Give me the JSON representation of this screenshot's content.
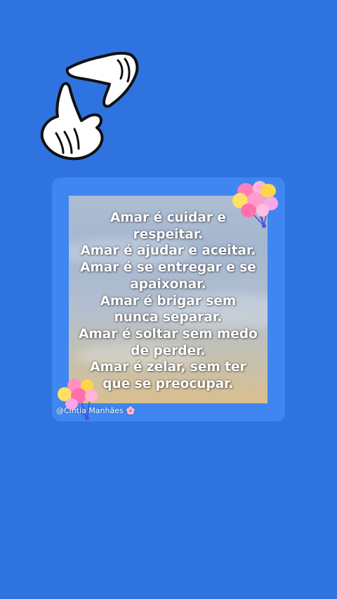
{
  "quote": {
    "lines": [
      "Amar é cuidar e",
      "respeitar.",
      "Amar é ajudar e aceitar.",
      "Amar é se entregar e se",
      "apaixonar.",
      "Amar é brigar sem",
      "nunca separar.",
      "Amar é soltar sem medo",
      "de perder.",
      "Amar é zelar, sem ter",
      "que se preocupar."
    ]
  },
  "credit": {
    "handle": "@Cintia Manhães",
    "flower_icon": "🌸"
  },
  "decor": {
    "top": "framing-hands-icon",
    "corners": "balloon-bunch-icon"
  },
  "colors": {
    "background": "#2f73e0",
    "card": "#3f86f0",
    "text": "#ffffff"
  }
}
